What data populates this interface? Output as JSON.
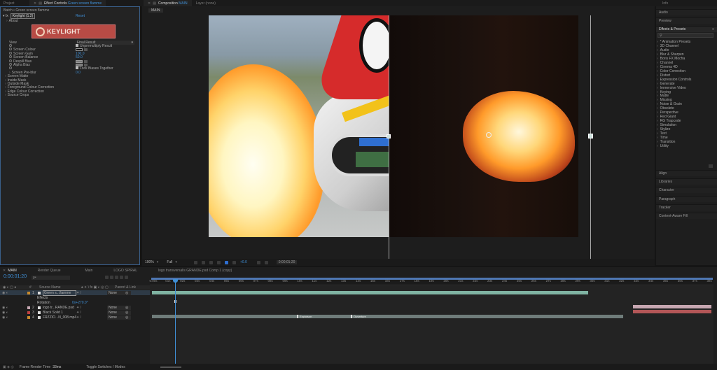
{
  "top_tabs": {
    "left": [
      {
        "label": "Project"
      },
      {
        "label": "Effect Controls",
        "highlight": "Green screen flamme"
      }
    ],
    "center": [
      {
        "label": "Composition",
        "highlight": "MAIN"
      },
      {
        "label": "Layer (none)"
      }
    ],
    "right": "Info"
  },
  "effect_controls": {
    "header": "Batch • Green screen flamme",
    "effect_name": "Keylight (1.2)",
    "reset": "Reset",
    "about": "About",
    "logo_text": "KEYLIGHT",
    "rows": [
      {
        "label": "View",
        "value": "Final Result"
      },
      {
        "label": "",
        "value": "Unpremultiply Result"
      },
      {
        "label": "Screen Colour",
        "value": ""
      },
      {
        "label": "Screen Gain",
        "value": "100.0"
      },
      {
        "label": "Screen Balance",
        "value": "50.0"
      },
      {
        "label": "Despill Bias",
        "value": ""
      },
      {
        "label": "Alpha Bias",
        "value": ""
      },
      {
        "label": "",
        "value": "Lock Biases Together"
      },
      {
        "label": "Screen Pre-blur",
        "value": "0.0"
      },
      {
        "label": "Screen Matte",
        "value": ""
      },
      {
        "label": "Inside Mask",
        "value": ""
      },
      {
        "label": "Outside Mask",
        "value": ""
      },
      {
        "label": "Foreground Colour Correction",
        "value": ""
      },
      {
        "label": "Edge Colour Correction",
        "value": ""
      },
      {
        "label": "Source Crops",
        "value": ""
      }
    ]
  },
  "viewer": {
    "comp_tab": "MAIN",
    "zoom": "100%",
    "resolution": "Full",
    "exposure": "+0.0",
    "timecode": "0:00:01:20"
  },
  "right_panel": {
    "audio": "Audio",
    "preview": "Preview",
    "effects_presets": "Effects & Presets",
    "search_placeholder": "🔍",
    "items": [
      "* Animation Presets",
      "3D Channel",
      "Audio",
      "Blur & Sharpen",
      "Boris FX Mocha",
      "Channel",
      "Cinema 4D",
      "Color Correction",
      "Distort",
      "Expression Controls",
      "Generate",
      "Immersive Video",
      "Keying",
      "Matte",
      "Missing",
      "Noise & Grain",
      "Obsolete",
      "Perspective",
      "Red Giant",
      "RG Trapcode",
      "Simulation",
      "Stylize",
      "Text",
      "Time",
      "Transition",
      "Utility"
    ],
    "bottom": [
      "Align",
      "Libraries",
      "Character",
      "Paragraph",
      "Tracker",
      "Content-Aware Fill"
    ]
  },
  "timeline": {
    "tabs": [
      "MAIN",
      "Render Queue",
      "Main",
      "LOGO SPIRAL",
      "logo transversalis GRANDE.psd Comp 1 (copy)"
    ],
    "timecode": "0:00:01:20",
    "search_placeholder": "ρ•",
    "headers": {
      "num": "#",
      "name": "Source Name",
      "switches": "♠ ✴ \\ fx ▣ ◐ ◎ ▢",
      "parent": "Parent & Link"
    },
    "layers": [
      {
        "num": "1",
        "name": "Green s...flamme",
        "parent": "None",
        "color": "#c88a2c",
        "selected": true
      },
      {
        "num": "",
        "name": "Effects",
        "parent": "",
        "color": "",
        "selected": false
      },
      {
        "num": "",
        "name": "Rotation",
        "parent": "",
        "value": "0x+270.0°",
        "color": "",
        "selected": false
      },
      {
        "num": "2",
        "name": "logo tr...RANDE.psd",
        "parent": "None",
        "color": "#c6a6b1",
        "selected": false
      },
      {
        "num": "3",
        "name": "Black Solid 1",
        "parent": "None",
        "color": "#c04040",
        "selected": false
      },
      {
        "num": "4",
        "name": "FRZZIO...N_008.mp4",
        "parent": "None",
        "color": "#c88a2c",
        "selected": false
      }
    ],
    "ruler": [
      "0:00s",
      "01s",
      "02s",
      "03s",
      "04s",
      "05s",
      "06s",
      "07s",
      "08s",
      "09s",
      "10s",
      "11s",
      "12s",
      "13s",
      "14s",
      "15s",
      "16s",
      "17s",
      "18s",
      "19s",
      "20s",
      "21s",
      "22s",
      "23s",
      "24s",
      "25s",
      "26s",
      "27s",
      "28s",
      "29s",
      "30s",
      "31s",
      "32s",
      "33s",
      "34s",
      "35s",
      "36s",
      "37s",
      "38s"
    ],
    "markers": [
      "Exploison",
      "Ouverture"
    ],
    "footer_left": "Frame Render Time",
    "footer_value": "33ms",
    "footer_mid": "Toggle Switches / Modes"
  },
  "colors": {
    "accent": "#3f8fd6",
    "bar_green": "#7fb3a2",
    "bar_pink": "#c6a6b1",
    "bar_red": "#b35657",
    "bar_grey": "#6f7c7a"
  }
}
